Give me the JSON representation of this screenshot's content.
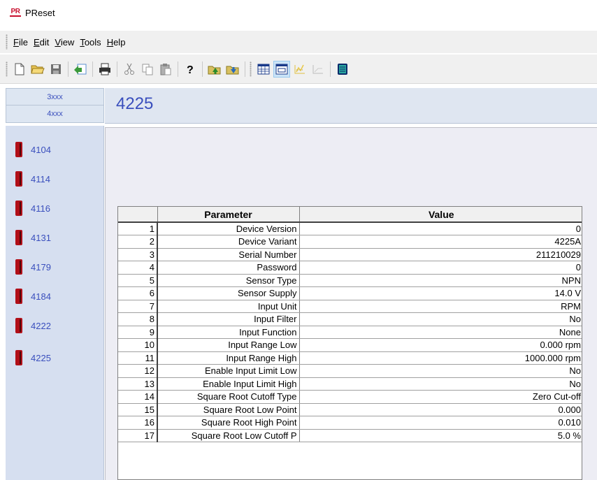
{
  "app": {
    "title": "PReset",
    "logo_text": "PR"
  },
  "menu": [
    "File",
    "Edit",
    "View",
    "Tools",
    "Help"
  ],
  "toolbar": {
    "buttons": [
      "new-icon",
      "open-icon",
      "save-icon",
      "import-icon",
      "print-icon",
      "cut-icon",
      "copy-icon",
      "paste-icon",
      "help-icon",
      "upload-icon",
      "download-icon",
      "table-view-icon",
      "form-view-icon",
      "chart-icon",
      "graph-icon",
      "monitor-icon"
    ]
  },
  "device_tabs": [
    "3xxx",
    "4xxx"
  ],
  "devices": [
    "4104",
    "4114",
    "4116",
    "4131",
    "4179",
    "4184",
    "4222",
    "4225"
  ],
  "page_title": "4225",
  "table": {
    "headers": [
      "",
      "Parameter",
      "Value"
    ],
    "rows": [
      {
        "n": "1",
        "param": "Device Version",
        "value": "0"
      },
      {
        "n": "2",
        "param": "Device Variant",
        "value": "4225A"
      },
      {
        "n": "3",
        "param": "Serial Number",
        "value": "211210029"
      },
      {
        "n": "4",
        "param": "Password",
        "value": "0"
      },
      {
        "n": "5",
        "param": "Sensor Type",
        "value": "NPN"
      },
      {
        "n": "6",
        "param": "Sensor Supply",
        "value": "14.0 V"
      },
      {
        "n": "7",
        "param": "Input Unit",
        "value": "RPM"
      },
      {
        "n": "8",
        "param": "Input Filter",
        "value": "No"
      },
      {
        "n": "9",
        "param": "Input Function",
        "value": "None"
      },
      {
        "n": "10",
        "param": "Input Range Low",
        "value": "0.000 rpm"
      },
      {
        "n": "11",
        "param": "Input Range High",
        "value": "1000.000 rpm"
      },
      {
        "n": "12",
        "param": "Enable Input Limit Low",
        "value": "No"
      },
      {
        "n": "13",
        "param": "Enable Input Limit High",
        "value": "No"
      },
      {
        "n": "14",
        "param": "Square Root Cutoff Type",
        "value": "Zero Cut-off"
      },
      {
        "n": "15",
        "param": "Square Root Low Point",
        "value": "0.000"
      },
      {
        "n": "16",
        "param": "Square Root High Point",
        "value": "0.010"
      },
      {
        "n": "17",
        "param": "Square Root Low Cutoff P",
        "value": "5.0 %"
      }
    ]
  },
  "colors": {
    "accent_text": "#3a4fbd",
    "sidebar_bg": "#d6dff0",
    "device_red": "#b10f18"
  }
}
